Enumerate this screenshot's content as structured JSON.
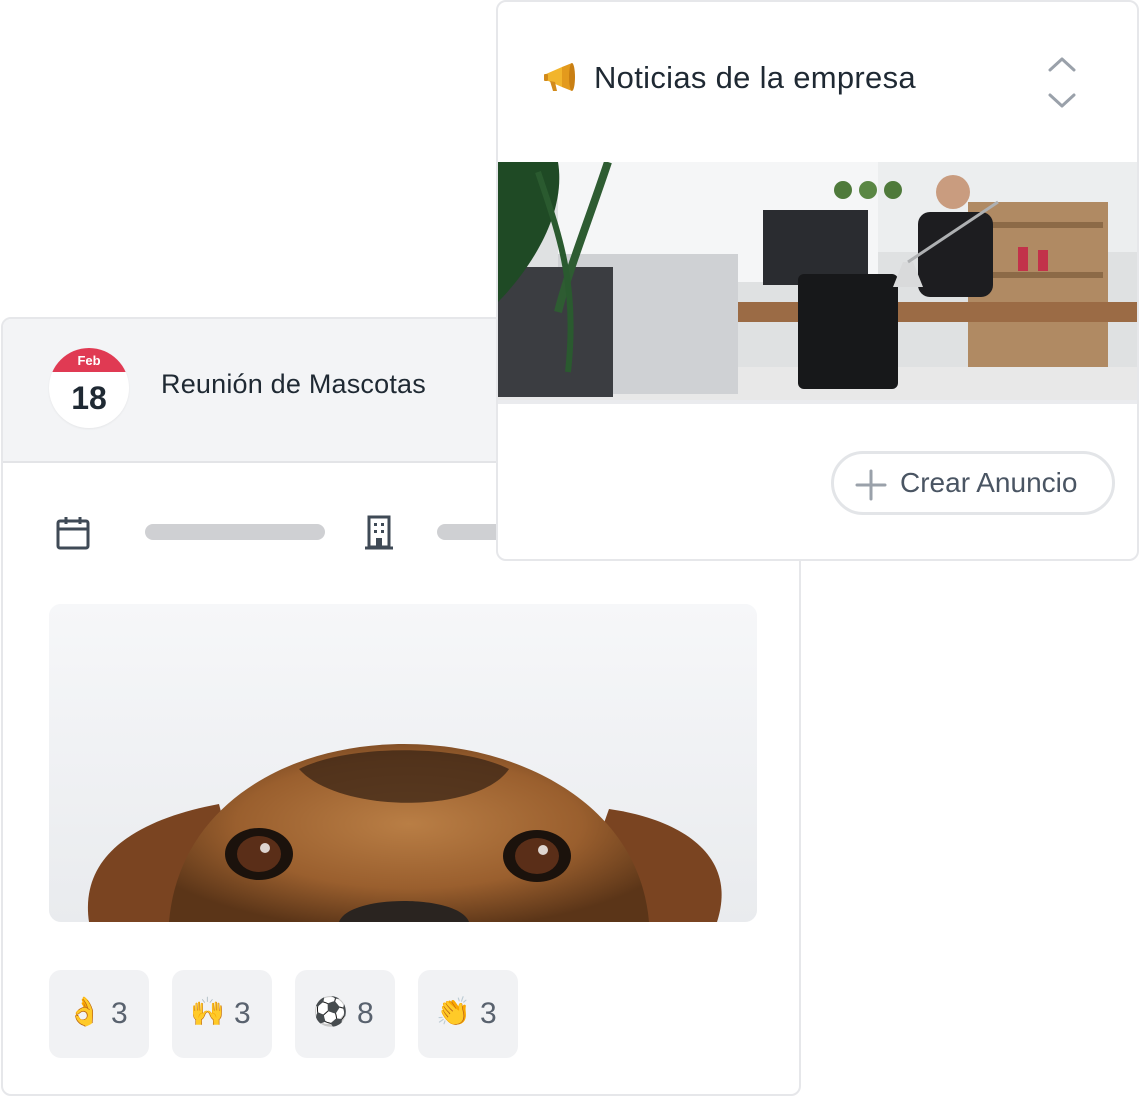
{
  "event": {
    "date_month": "Feb",
    "date_day": "18",
    "title": "Reunión de Mascotas",
    "reactions": [
      {
        "emoji": "👌",
        "icon": "ok-hand-icon",
        "count": "3"
      },
      {
        "emoji": "🙌",
        "icon": "raised-hands-icon",
        "count": "3"
      },
      {
        "emoji": "⚽",
        "icon": "soccer-ball-icon",
        "count": "8"
      },
      {
        "emoji": "👏",
        "icon": "clapping-hands-icon",
        "count": "3"
      }
    ]
  },
  "news": {
    "title": "Noticias de la empresa",
    "create_label": "Crear Anuncio"
  },
  "icons": {
    "calendar": "calendar-icon",
    "building": "building-icon",
    "megaphone": "megaphone-icon",
    "sort": "sort-chevrons-icon",
    "plus": "plus-icon"
  },
  "colors": {
    "date_badge_accent": "#e03a53",
    "header_bg": "#f3f4f6",
    "skeleton": "#cfd0d3",
    "reaction_bg": "#f1f2f4"
  }
}
